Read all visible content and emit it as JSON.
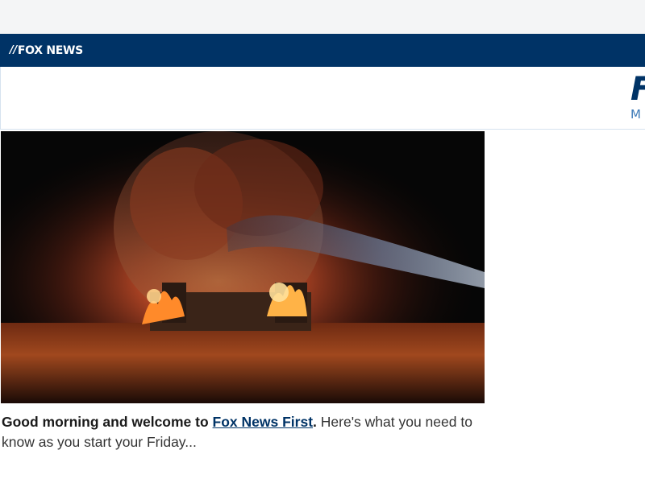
{
  "brand": {
    "logo_text": "FOX NEWS"
  },
  "subheader": {
    "title_fragment": "F",
    "subtitle_fragment": "M"
  },
  "hero_image": {
    "description_icon": "boat-fire-photo"
  },
  "intro": {
    "greeting": "Good morning and welcome to ",
    "link_text": "Fox News First",
    "period": ".",
    "rest": " Here's what you need to know as you start your Friday..."
  },
  "colors": {
    "brand_bar": "#003366",
    "link": "#003366",
    "subtitle": "#3e7bb8"
  }
}
